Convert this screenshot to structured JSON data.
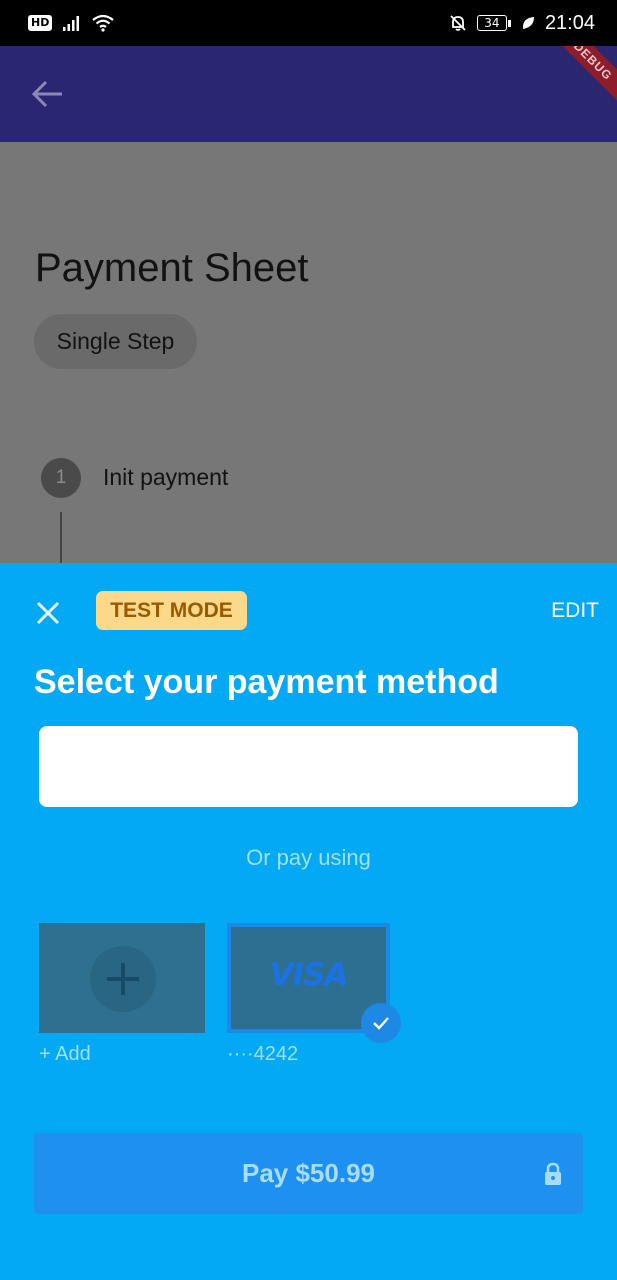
{
  "status_bar": {
    "hd": "HD",
    "battery": "34",
    "time": "21:04"
  },
  "app_bar": {
    "debug_banner": "DEBUG"
  },
  "page": {
    "title": "Payment Sheet",
    "chip_label": "Single Step",
    "step": {
      "number": "1",
      "label": "Init payment"
    }
  },
  "sheet": {
    "badge": "TEST MODE",
    "edit_label": "EDIT",
    "title": "Select your payment method",
    "or_text": "Or pay using",
    "options": {
      "add_label": "+ Add",
      "card_label": "····4242",
      "card_brand": "VISA"
    },
    "pay_button": "Pay $50.99"
  },
  "colors": {
    "sheet_bg": "#03a9f4",
    "app_bar": "#2a2672",
    "badge_bg": "#fbd88a",
    "pay_button": "#1e90f0"
  }
}
